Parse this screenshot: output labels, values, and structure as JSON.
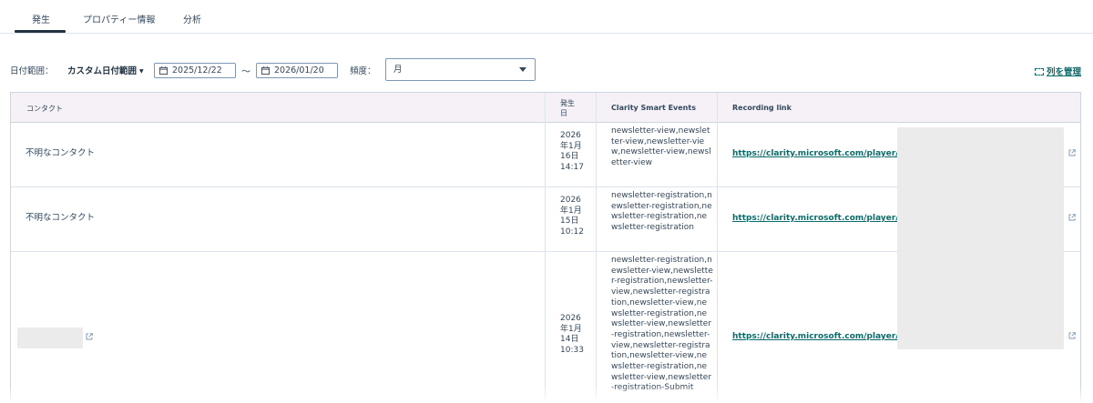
{
  "tabs": [
    {
      "label": "発生",
      "active": true
    },
    {
      "label": "プロパティー情報",
      "active": false
    },
    {
      "label": "分析",
      "active": false
    }
  ],
  "filters": {
    "date_range_label": "日付範囲：",
    "date_range_value": "カスタム日付範囲",
    "start_date": "2025/12/22",
    "separator": "〜",
    "end_date": "2026/01/20",
    "frequency_label": "頻度：",
    "frequency_value": "月"
  },
  "manage_columns_label": "列を管理",
  "table": {
    "headers": {
      "contact": "コンタクト",
      "occurred_line1": "発生",
      "occurred_line2": "日",
      "events": "Clarity Smart Events",
      "recording": "Recording link"
    },
    "rows": [
      {
        "contact": "不明なコンタクト",
        "date": [
          "2026",
          "年1月",
          "16日",
          "14:17"
        ],
        "events": "newsletter-view,newsletter-view,newsletter-view,newsletter-view,newsletter-view",
        "link": "https://clarity.microsoft.com/player/g"
      },
      {
        "contact": "不明なコンタクト",
        "date": [
          "2026",
          "年1月",
          "15日",
          "10:12"
        ],
        "events": "newsletter-registration,newsletter-registration,newsletter-registration,newsletter-registration",
        "link": "https://clarity.microsoft.com/player/g"
      },
      {
        "contact": "",
        "date": [
          "2026",
          "年1月",
          "14日",
          "10:33"
        ],
        "events": "newsletter-registration,newsletter-view,newsletter-registration,newsletter-view,newsletter-registration,newsletter-view,newsletter-registration,newsletter-view,newsletter-registration,newsletter-view,newsletter-registration,newsletter-view,newsletter-registration,newsletter-view,newsletter-registration-Submit",
        "link": "https://clarity.microsoft.com/player/g"
      }
    ]
  },
  "colors": {
    "accent_link": "#0b6b6b",
    "header_bg": "#f5f1f7",
    "text": "#33475b"
  }
}
